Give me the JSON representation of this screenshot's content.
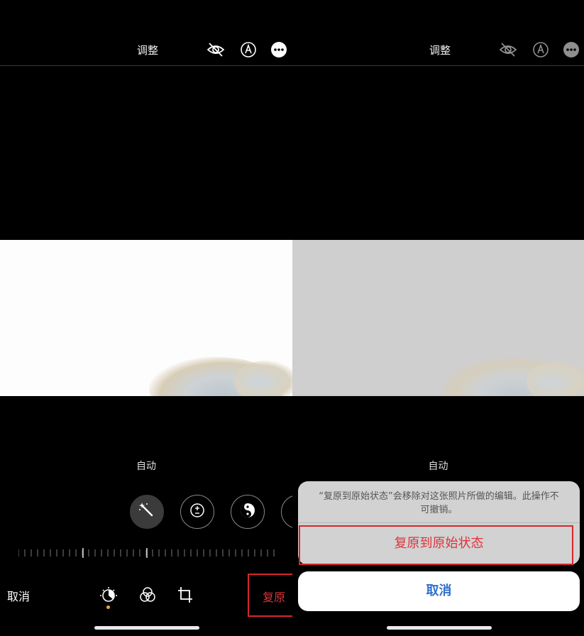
{
  "left": {
    "header": {
      "title": "调整"
    },
    "adjust_label": "自动",
    "bottom": {
      "cancel_label": "取消",
      "revert_label": "复原"
    }
  },
  "right": {
    "header": {
      "title": "调整"
    },
    "adjust_label": "自动",
    "action_sheet": {
      "message": "“复原到原始状态”会移除对这张照片所做的编辑。此操作不可撤销。",
      "revert_action": "复原到原始状态",
      "cancel_label": "取消"
    }
  },
  "colors": {
    "background": "#000000",
    "highlight_box": "#d8262c",
    "destructive": "#e0333a",
    "cancel_blue": "#2f6fc9",
    "active_dot": "#f5a623"
  },
  "icons": {
    "hide": "eye-slash-icon",
    "markup": "pen-tip-icon",
    "more": "ellipsis-circle-icon",
    "auto": "magic-wand-icon",
    "exposure": "plus-minus-icon",
    "brilliance": "yin-yang-icon",
    "adjust_tab": "dial-icon",
    "filters_tab": "filters-icon",
    "crop_tab": "crop-rotate-icon"
  }
}
